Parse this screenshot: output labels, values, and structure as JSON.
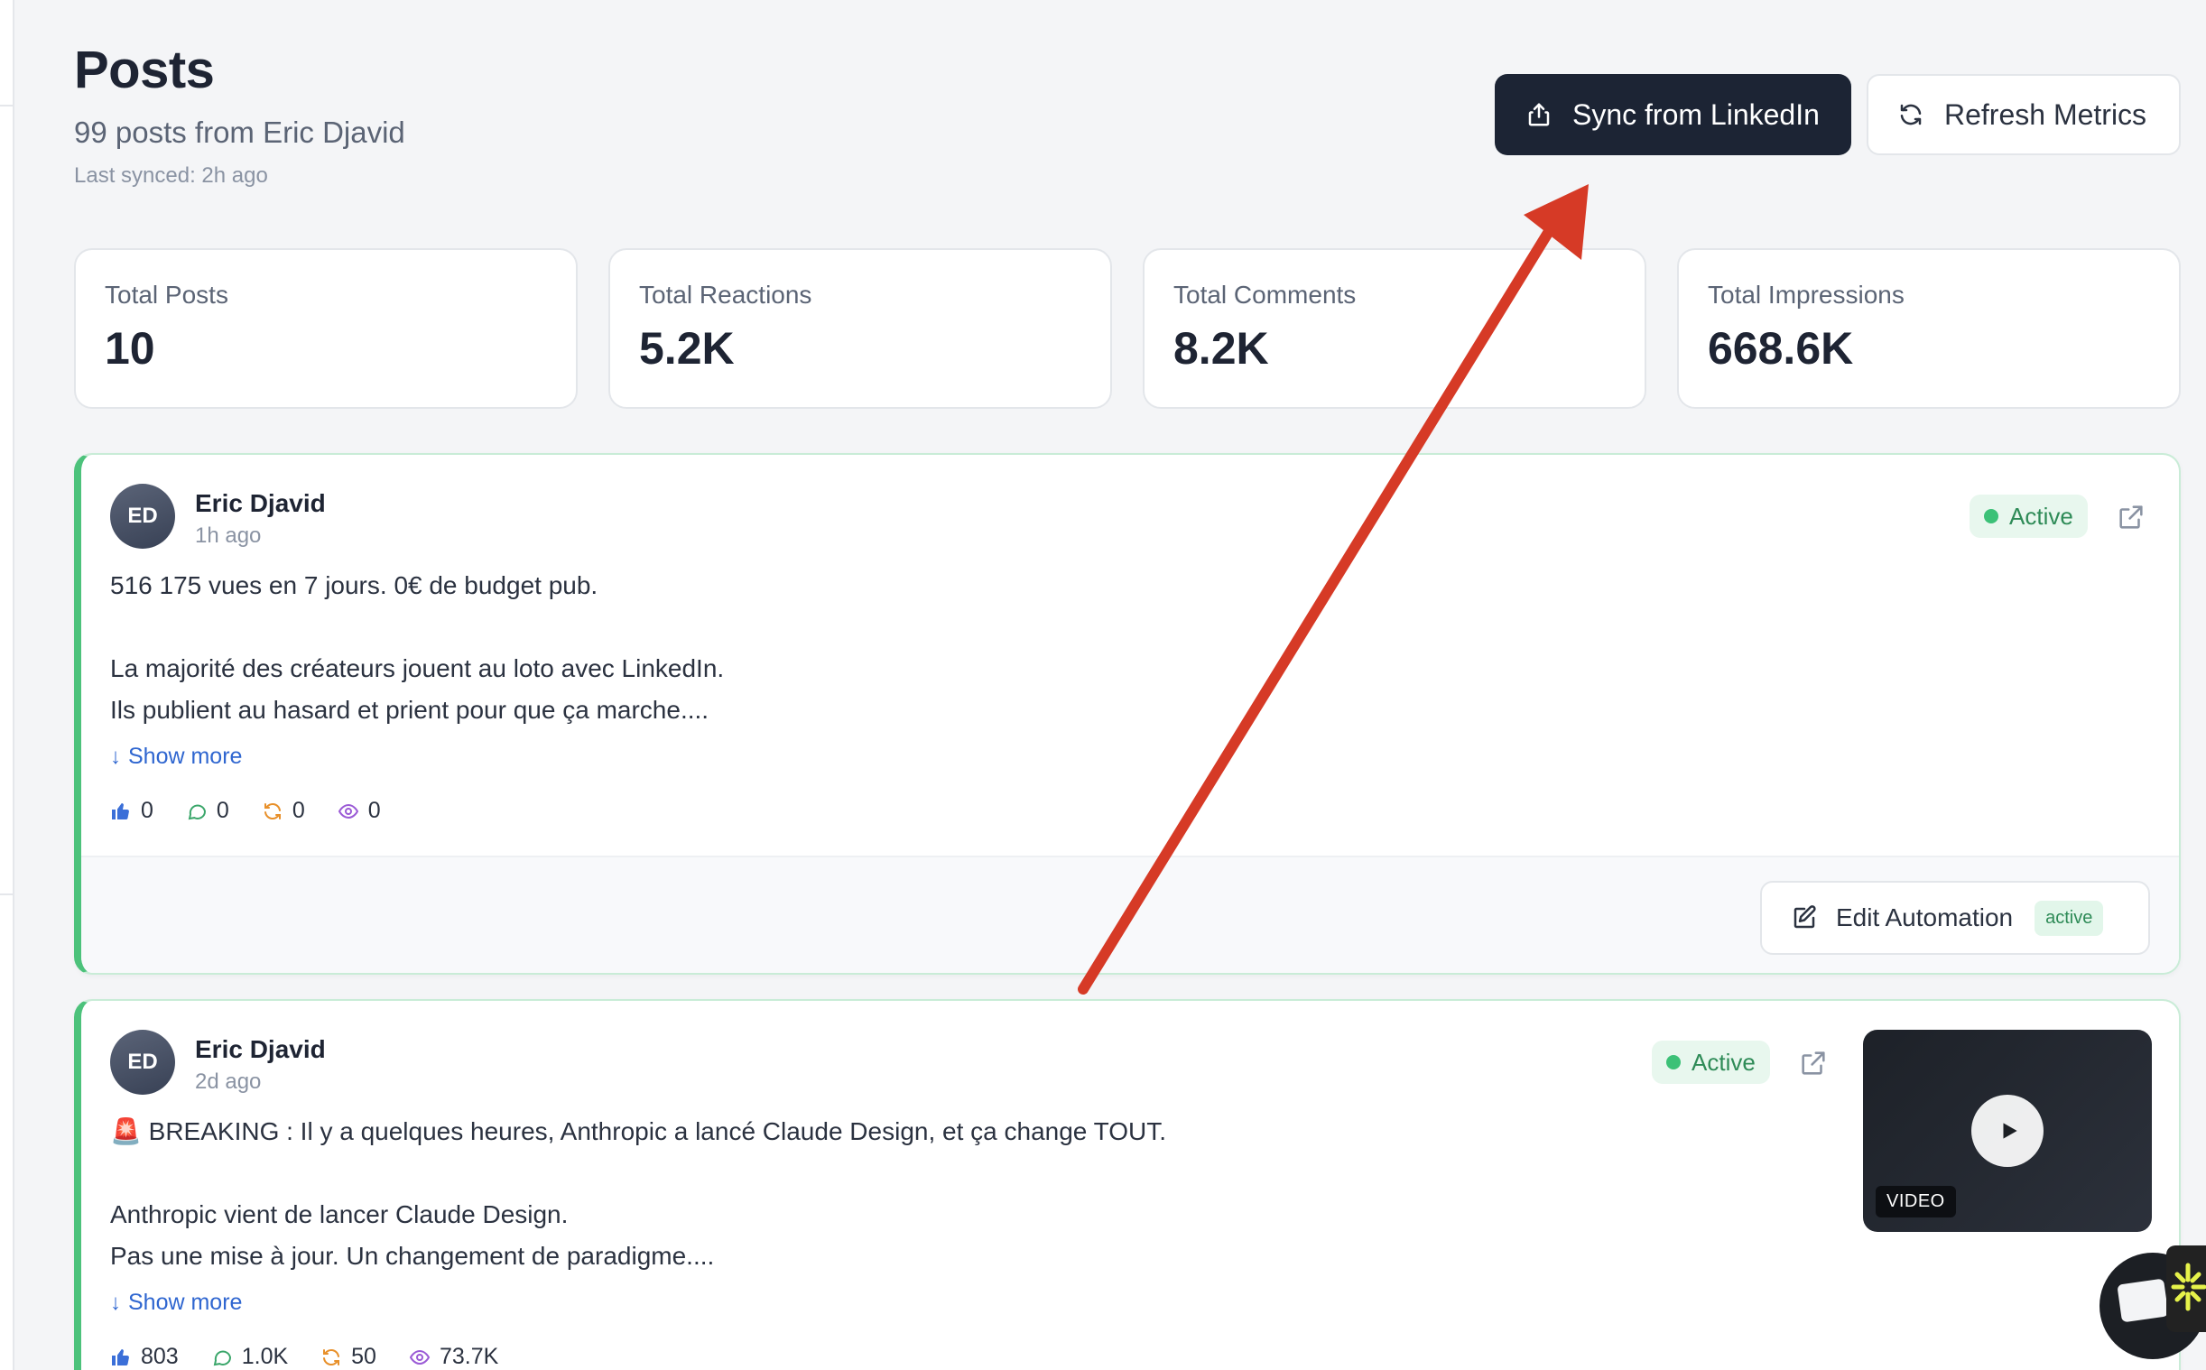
{
  "header": {
    "title": "Posts",
    "subtitle": "99 posts from Eric Djavid",
    "last_synced": "Last synced: 2h ago"
  },
  "actions": {
    "sync_label": "Sync from LinkedIn",
    "refresh_label": "Refresh Metrics"
  },
  "stats": [
    {
      "label": "Total Posts",
      "value": "10"
    },
    {
      "label": "Total Reactions",
      "value": "5.2K"
    },
    {
      "label": "Total Comments",
      "value": "8.2K"
    },
    {
      "label": "Total Impressions",
      "value": "668.6K"
    }
  ],
  "posts": [
    {
      "avatar_initials": "ED",
      "author": "Eric Djavid",
      "time": "1h ago",
      "status": "Active",
      "lines": [
        "516 175 vues en 7 jours. 0€ de budget pub.",
        "",
        "La majorité des créateurs jouent au loto avec LinkedIn.",
        "Ils publient au hasard et prient pour que ça marche...."
      ],
      "show_more": "Show more",
      "metrics": {
        "reactions": "0",
        "comments": "0",
        "reposts": "0",
        "impressions": "0"
      },
      "edit_label": "Edit Automation",
      "edit_badge": "active"
    },
    {
      "avatar_initials": "ED",
      "author": "Eric Djavid",
      "time": "2d ago",
      "status": "Active",
      "lines": [
        "🚨 BREAKING : Il y a quelques heures, Anthropic a lancé Claude Design, et ça change TOUT.",
        "",
        "Anthropic vient de lancer Claude Design.",
        "Pas une mise à jour. Un changement de paradigme...."
      ],
      "show_more": "Show more",
      "metrics": {
        "reactions": "803",
        "comments": "1.0K",
        "reposts": "50",
        "impressions": "73.7K"
      },
      "video_label": "VIDEO"
    }
  ],
  "colors": {
    "primary_button": "#1c2434",
    "active_green": "#3cc177",
    "card_accent": "#4cc27b",
    "link_blue": "#2f66d0",
    "annotation_arrow": "#d63a26"
  }
}
